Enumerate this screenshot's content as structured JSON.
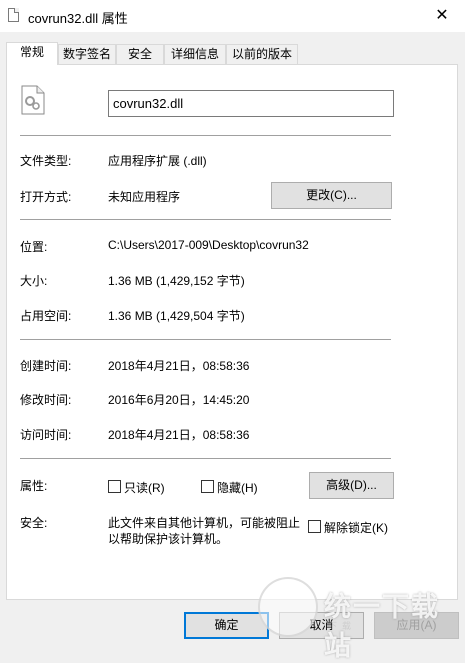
{
  "window": {
    "title": "covrun32.dll 属性",
    "close_glyph": "✕"
  },
  "tabs": [
    {
      "label": "常规"
    },
    {
      "label": "数字签名"
    },
    {
      "label": "安全"
    },
    {
      "label": "详细信息"
    },
    {
      "label": "以前的版本"
    }
  ],
  "general": {
    "filename": "covrun32.dll",
    "type_label": "文件类型:",
    "type_value": "应用程序扩展 (.dll)",
    "opens_label": "打开方式:",
    "opens_value": "未知应用程序",
    "change_button": "更改(C)...",
    "location_label": "位置:",
    "location_value": "C:\\Users\\2017-009\\Desktop\\covrun32",
    "size_label": "大小:",
    "size_value": "1.36 MB (1,429,152 字节)",
    "disk_label": "占用空间:",
    "disk_value": "1.36 MB (1,429,504 字节)",
    "created_label": "创建时间:",
    "created_value": "2018年4月21日，08:58:36",
    "modified_label": "修改时间:",
    "modified_value": "2016年6月20日，14:45:20",
    "accessed_label": "访问时间:",
    "accessed_value": "2018年4月21日，08:58:36",
    "attributes_label": "属性:",
    "readonly_label": "只读(R)",
    "hidden_label": "隐藏(H)",
    "advanced_button": "高级(D)...",
    "security_label": "安全:",
    "security_line1": "此文件来自其他计算机，可能被阻止",
    "security_line2": "以帮助保护该计算机。",
    "unblock_label": "解除锁定(K)"
  },
  "footer": {
    "ok": "确定",
    "cancel": "取消",
    "apply": "应用(A)"
  },
  "watermark": {
    "text": "统一下载站",
    "sub": "下载"
  }
}
